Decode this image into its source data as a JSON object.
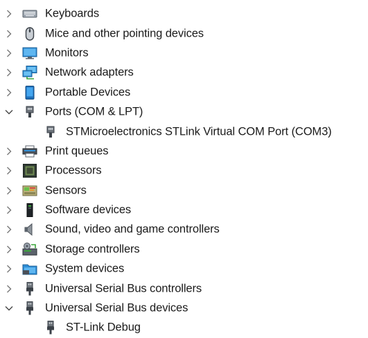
{
  "tree": {
    "items": [
      {
        "label": "Keyboards",
        "icon": "keyboard-icon",
        "expanded": false,
        "level": 0
      },
      {
        "label": "Mice and other pointing devices",
        "icon": "mouse-icon",
        "expanded": false,
        "level": 0
      },
      {
        "label": "Monitors",
        "icon": "monitor-icon",
        "expanded": false,
        "level": 0
      },
      {
        "label": "Network adapters",
        "icon": "network-adapter-icon",
        "expanded": false,
        "level": 0
      },
      {
        "label": "Portable Devices",
        "icon": "portable-device-icon",
        "expanded": false,
        "level": 0
      },
      {
        "label": "Ports (COM & LPT)",
        "icon": "port-icon",
        "expanded": true,
        "level": 0
      },
      {
        "label": "STMicroelectronics STLink Virtual COM Port (COM3)",
        "icon": "port-icon",
        "level": 1
      },
      {
        "label": "Print queues",
        "icon": "printer-icon",
        "expanded": false,
        "level": 0
      },
      {
        "label": "Processors",
        "icon": "processor-icon",
        "expanded": false,
        "level": 0
      },
      {
        "label": "Sensors",
        "icon": "sensor-icon",
        "expanded": false,
        "level": 0
      },
      {
        "label": "Software devices",
        "icon": "software-device-icon",
        "expanded": false,
        "level": 0
      },
      {
        "label": "Sound, video and game controllers",
        "icon": "speaker-icon",
        "expanded": false,
        "level": 0
      },
      {
        "label": "Storage controllers",
        "icon": "storage-controller-icon",
        "expanded": false,
        "level": 0
      },
      {
        "label": "System devices",
        "icon": "system-folder-icon",
        "expanded": false,
        "level": 0
      },
      {
        "label": "Universal Serial Bus controllers",
        "icon": "usb-icon",
        "expanded": false,
        "level": 0
      },
      {
        "label": "Universal Serial Bus devices",
        "icon": "usb-icon",
        "expanded": true,
        "level": 0
      },
      {
        "label": "ST-Link Debug",
        "icon": "usb-icon",
        "level": 1
      }
    ]
  }
}
